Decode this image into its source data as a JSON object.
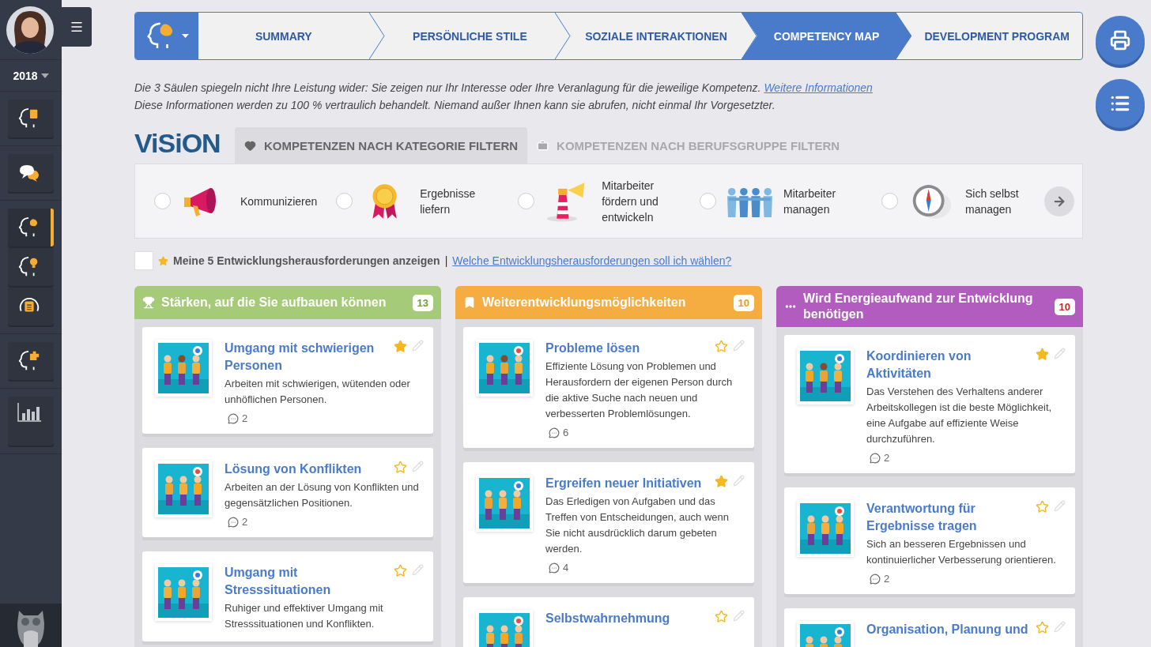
{
  "sidebar": {
    "year": "2018",
    "nav_groups": [
      [
        {
          "selected": false
        }
      ],
      [
        {
          "selected": false
        }
      ],
      [
        {
          "selected": true
        },
        {
          "selected": false
        },
        {
          "selected": false
        }
      ],
      [
        {
          "selected": false
        }
      ],
      [
        {
          "selected": false
        }
      ]
    ]
  },
  "stepper": {
    "steps": [
      {
        "label": "SUMMARY",
        "selected": false
      },
      {
        "label": "PERSÖNLICHE STILE",
        "selected": false
      },
      {
        "label": "SOZIALE INTERAKTIONEN",
        "selected": false
      },
      {
        "label": "COMPETENCY MAP",
        "selected": true
      },
      {
        "label": "DEVELOPMENT PROGRAM",
        "selected": false
      }
    ]
  },
  "info": {
    "line_1": "Die 3 Säulen spiegeln nicht Ihre Leistung wider: Sie zeigen nur Ihr Interesse oder Ihre Veranlagung für die jeweilige Kompetenz.",
    "link": "Weitere Informationen",
    "line_2": "Diese Informationen werden zu 100 % vertraulich behandelt. Niemand außer Ihnen kann sie abrufen, nicht einmal Ihr Vorgesetzter."
  },
  "logo": "ViSiON",
  "filter_tabs": [
    {
      "label": "KOMPETENZEN NACH KATEGORIE FILTERN",
      "selected": true
    },
    {
      "label": "KOMPETENZEN NACH BERUFSGRUPPE FILTERN",
      "selected": false
    }
  ],
  "categories": [
    {
      "label": "Kommunizieren",
      "checked": false
    },
    {
      "label": "Ergebnisse liefern",
      "checked": false
    },
    {
      "label": "Mitarbeiter fördern und entwickeln",
      "checked": false
    },
    {
      "label": "Mitarbeiter managen",
      "checked": false
    },
    {
      "label": "Sich selbst managen",
      "checked": false
    }
  ],
  "challenges_toggle": {
    "checked": false,
    "label": "Meine 5 Entwicklungsherausforderungen anzeigen",
    "separator": "|",
    "link": "Welche Entwicklungsherausforderungen soll ich wählen?"
  },
  "columns": [
    {
      "kind": "strengths",
      "title": "Stärken, auf die Sie aufbauen können",
      "count": "13",
      "cards": [
        {
          "title": "Umgang mit schwierigen Personen",
          "description": "Arbeiten mit schwierigen, wütenden oder unhöflichen Personen.",
          "comments": "2",
          "starred": true
        },
        {
          "title": "Lösung von Konflikten",
          "description": "Arbeiten an der Lösung von Konflikten und gegensätzlichen Positionen.",
          "comments": "2",
          "starred": false
        },
        {
          "title": "Umgang mit Stresssituationen",
          "description": "Ruhiger und effektiver Umgang mit Stresssituationen und Konflikten.",
          "starred": false
        }
      ]
    },
    {
      "kind": "opportunities",
      "title": "Weiterentwicklungsmöglichkeiten",
      "count": "10",
      "cards": [
        {
          "title": "Probleme lösen",
          "description": "Effiziente Lösung von Problemen und Herausfordern der eigenen Person durch die aktive Suche nach neuen und verbesserten Problemlösungen.",
          "comments": "6",
          "starred": false
        },
        {
          "title": "Ergreifen neuer Initiativen",
          "description": "Das Erledigen von Aufgaben und das Treffen von Entscheidungen, auch wenn Sie nicht ausdrücklich darum gebeten werden.",
          "comments": "4",
          "starred": true
        },
        {
          "title": "Selbstwahrnehmung",
          "starred": false
        }
      ]
    },
    {
      "kind": "effort",
      "title": "Wird Energieaufwand zur Entwicklung benötigen",
      "count": "10",
      "cards": [
        {
          "title": "Koordinieren von Aktivitäten",
          "description": "Das Verstehen des Verhaltens anderer Arbeitskollegen ist die beste Möglichkeit, eine Aufgabe auf effiziente Weise durchzuführen.",
          "comments": "2",
          "starred": true
        },
        {
          "title": "Verantwortung für Ergebnisse tragen",
          "description": "Sich an besseren Ergebnissen und kontinuierlicher Verbesserung orientieren.",
          "comments": "2",
          "starred": false
        },
        {
          "title": "Organisation, Planung und",
          "starred": false
        }
      ]
    }
  ]
}
